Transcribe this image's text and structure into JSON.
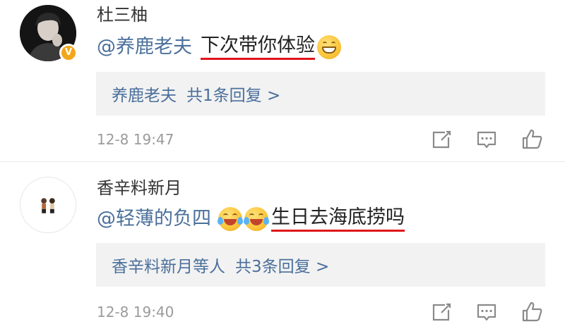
{
  "comments": [
    {
      "username": "杜三柚",
      "mention": "@养鹿老夫",
      "text": "下次带你体验",
      "emoji": "grinning-face-emoji",
      "reply_summary": {
        "names": "养鹿老夫",
        "count_text": "共1条回复 >"
      },
      "timestamp": "12-8 19:47",
      "verified_badge": "V"
    },
    {
      "username": "香辛料新月",
      "mention": "@轻薄的负四",
      "text": "生日去海底捞吗",
      "emoji": "tears-of-joy-emoji",
      "reply_summary": {
        "names": "香辛料新月等人",
        "count_text": "共3条回复 >"
      },
      "timestamp": "12-8 19:40"
    }
  ],
  "icons": {
    "share": "share-icon",
    "comment": "comment-icon",
    "like": "thumbs-up-icon"
  },
  "colors": {
    "link": "#4a6f9b",
    "underline": "#e0151b",
    "reply_bg": "#f2f2f2",
    "timestamp": "#9b9b9b",
    "verified": "#f3a61a"
  }
}
